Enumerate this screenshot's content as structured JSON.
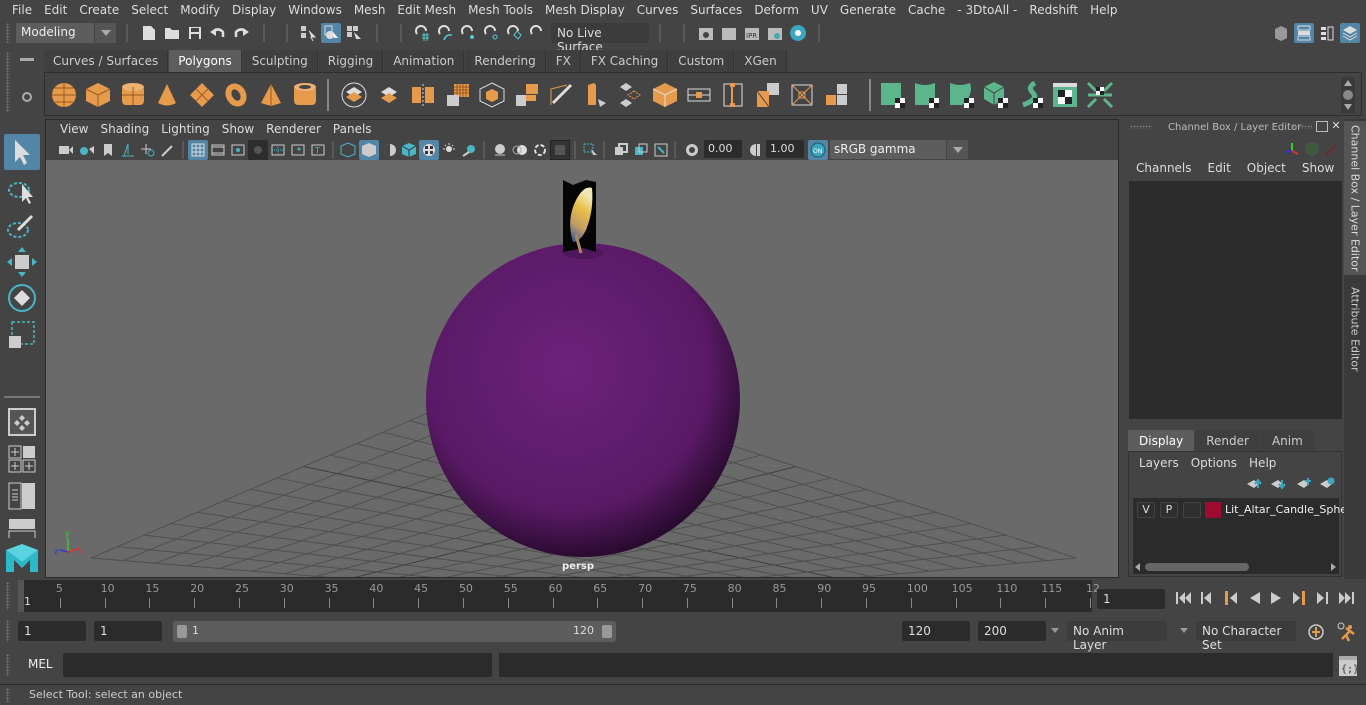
{
  "menubar": [
    "File",
    "Edit",
    "Create",
    "Select",
    "Modify",
    "Display",
    "Windows",
    "Mesh",
    "Edit Mesh",
    "Mesh Tools",
    "Mesh Display",
    "Curves",
    "Surfaces",
    "Deform",
    "UV",
    "Generate",
    "Cache",
    "- 3DtoAll -",
    "Redshift",
    "Help"
  ],
  "statusline": {
    "workspace": "Modeling",
    "live_surface": "No Live Surface"
  },
  "shelf": {
    "tabs": [
      "Curves / Surfaces",
      "Polygons",
      "Sculpting",
      "Rigging",
      "Animation",
      "Rendering",
      "FX",
      "FX Caching",
      "Custom",
      "XGen"
    ],
    "active_tab": "Polygons",
    "icons": [
      "poly-sphere-icon",
      "poly-cube-icon",
      "poly-cylinder-icon",
      "poly-cone-icon",
      "poly-plane-icon",
      "poly-torus-icon",
      "poly-pyramid-icon",
      "poly-pipe-icon",
      "combine-icon",
      "separate-icon",
      "mirror-icon",
      "smooth-icon",
      "extrude-icon",
      "bridge-icon",
      "multi-cut-icon",
      "bevel-icon",
      "append-polygon-icon",
      "insert-edge-loop-icon",
      "merge-icon",
      "edge-loop-icon",
      "target-weld-icon",
      "fill-hole-icon",
      "offset-edge-icon",
      "automatic-uv-icon",
      "planar-uv-icon",
      "cylindrical-uv-icon",
      "spherical-uv-icon",
      "camera-uv-icon",
      "unfold-uv-icon",
      "uv-editor-icon",
      "uv-layout-icon"
    ]
  },
  "viewport": {
    "menu": [
      "View",
      "Shading",
      "Lighting",
      "Show",
      "Renderer",
      "Panels"
    ],
    "exposure": "0.00",
    "gamma": "1.00",
    "color_space": "sRGB gamma",
    "color_mgmt_label": "ON",
    "camera_label": "persp",
    "axis": {
      "x": "x",
      "y": "y",
      "z": "z"
    },
    "colors": {
      "sphere": "#5a1a66",
      "background": "#6a6a6a",
      "grid": "#4f4f4f"
    }
  },
  "channelbox": {
    "title": "Channel Box / Layer Editor",
    "menu": [
      "Channels",
      "Edit",
      "Object",
      "Show"
    ]
  },
  "layereditor": {
    "tabs": [
      "Display",
      "Render",
      "Anim"
    ],
    "active_tab": "Display",
    "menu": [
      "Layers",
      "Options",
      "Help"
    ],
    "layers": [
      {
        "v": "V",
        "p": "P",
        "name": "Lit_Altar_Candle_Sphe",
        "color": "#9e0b2f"
      }
    ]
  },
  "side_tabs": [
    "Channel Box / Layer Editor",
    "Attribute Editor"
  ],
  "timeslider": {
    "ticks": [
      "5",
      "10",
      "15",
      "20",
      "25",
      "30",
      "35",
      "40",
      "45",
      "50",
      "55",
      "60",
      "65",
      "70",
      "75",
      "80",
      "85",
      "90",
      "95",
      "100",
      "105",
      "110",
      "115",
      "12"
    ],
    "current_frame_marker": "1",
    "current_frame": "1"
  },
  "range": {
    "start": "1",
    "playback_start": "1",
    "slider_start": "1",
    "slider_end": "120",
    "playback_end": "120",
    "end": "200",
    "anim_layer": "No Anim Layer",
    "character_set": "No Character Set"
  },
  "cmdline": {
    "label": "MEL",
    "value": ""
  },
  "helpline": {
    "text": "Select Tool: select an object"
  }
}
